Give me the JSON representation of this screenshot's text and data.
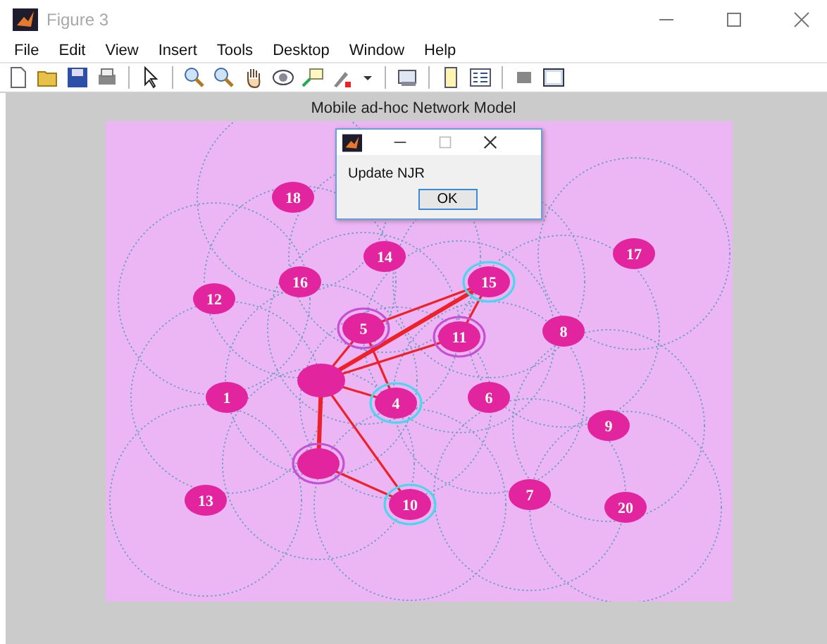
{
  "window": {
    "title": "Figure 3",
    "active": false
  },
  "menu": [
    "File",
    "Edit",
    "View",
    "Insert",
    "Tools",
    "Desktop",
    "Window",
    "Help"
  ],
  "figure": {
    "title": "Mobile ad-hoc Network Model",
    "nodes": [
      {
        "kind": "node",
        "label": "18"
      },
      {
        "kind": "node",
        "label": "16"
      },
      {
        "kind": "node",
        "label": "14"
      },
      {
        "kind": "node",
        "label": "12"
      },
      {
        "kind": "node",
        "label": "5",
        "color": "#c74fd6"
      },
      {
        "kind": "node",
        "label": "11",
        "color": "#c74fd6"
      },
      {
        "kind": "node",
        "label": "15",
        "color": "#49d7f0"
      },
      {
        "kind": "node",
        "label": "17"
      },
      {
        "kind": "node",
        "label": "8"
      },
      {
        "kind": "node",
        "label": "1"
      },
      {
        "kind": "hub"
      },
      {
        "kind": "node",
        "label": "4",
        "color": "#49d7f0"
      },
      {
        "kind": "node",
        "label": "6"
      },
      {
        "kind": "node",
        "label": "9"
      },
      {
        "kind": "node",
        "color": "#c74fd6"
      },
      {
        "kind": "node",
        "label": "13"
      },
      {
        "kind": "node",
        "label": "10",
        "color": "#49d7f0"
      },
      {
        "kind": "node",
        "label": "7"
      },
      {
        "kind": "node",
        "label": "20"
      }
    ]
  },
  "dialog": {
    "message": "Update NJR",
    "buttons": [
      "OK"
    ]
  }
}
